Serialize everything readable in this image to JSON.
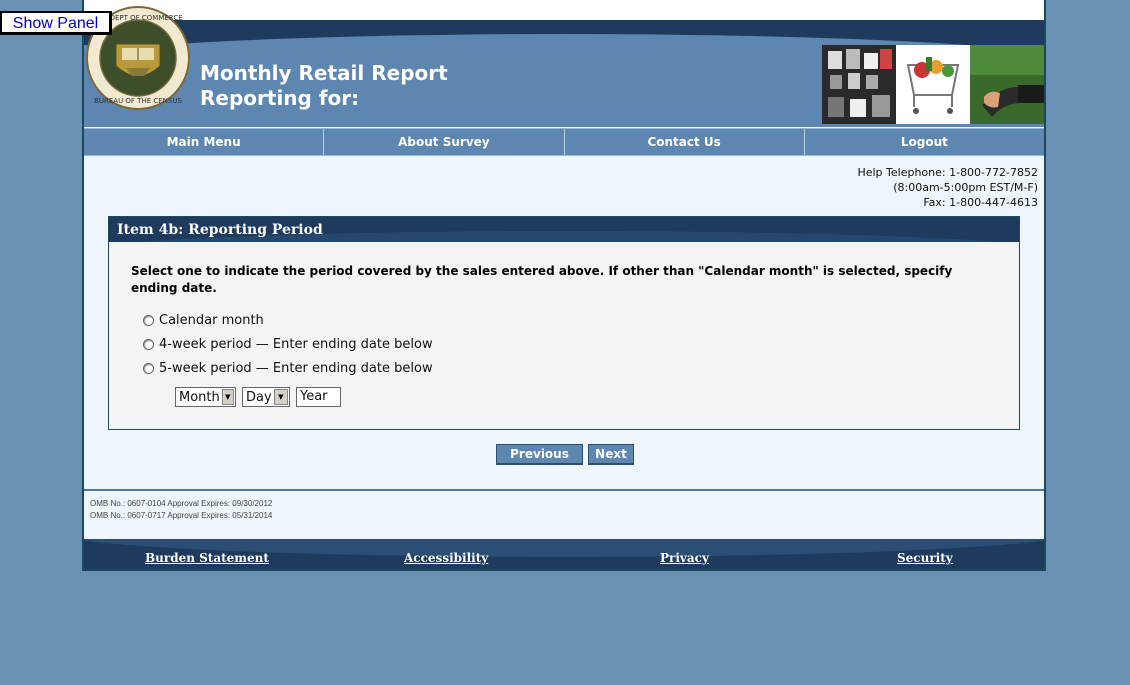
{
  "show_panel_label": "Show Panel",
  "header": {
    "title_line1": "Monthly Retail Report",
    "title_line2": "Reporting for:",
    "seal_text_top": "U.S. DEPARTMENT OF COMMERCE",
    "seal_text_bottom": "BUREAU OF THE CENSUS"
  },
  "nav": [
    "Main Menu",
    "About Survey",
    "Contact Us",
    "Logout"
  ],
  "help": {
    "telephone": "Help Telephone: 1-800-772-7852",
    "hours": "(8:00am-5:00pm EST/M-F)",
    "fax": "Fax: 1-800-447-4613"
  },
  "panel": {
    "title": "Item 4b: Reporting Period",
    "question": "Select one to indicate the period covered by the sales entered above. If other than \"Calendar month\" is selected, specify ending date.",
    "options": [
      "Calendar month",
      "4-week period — Enter ending date below",
      "5-week period — Enter ending date below"
    ],
    "month_select": "Month",
    "day_select": "Day",
    "year_placeholder": "Year"
  },
  "buttons": {
    "previous": "Previous",
    "next": "Next"
  },
  "omb": [
    "OMB No.: 0607-0104 Approval Expires: 09/30/2012",
    "OMB No.: 0607-0717 Approval Expires: 05/31/2014"
  ],
  "footer": [
    "Burden Statement",
    "Accessibility",
    "Privacy",
    "Security"
  ],
  "colors": {
    "background": "#6891b4",
    "header_blue": "#5d86b0",
    "dark_navy": "#1e3a5c",
    "content_bg": "#eef5fb"
  }
}
